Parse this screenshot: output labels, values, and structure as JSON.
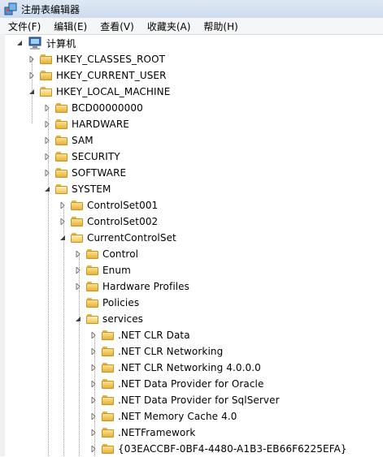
{
  "window": {
    "title": "注册表编辑器"
  },
  "menu": [
    "文件(F)",
    "编辑(E)",
    "查看(V)",
    "收藏夹(A)",
    "帮助(H)"
  ],
  "tree": {
    "root": "计算机",
    "nodes": [
      {
        "label": "HKEY_CLASSES_ROOT",
        "state": "collapsed"
      },
      {
        "label": "HKEY_CURRENT_USER",
        "state": "collapsed"
      },
      {
        "label": "HKEY_LOCAL_MACHINE",
        "state": "expanded"
      },
      {
        "label": "BCD00000000",
        "state": "collapsed"
      },
      {
        "label": "HARDWARE",
        "state": "collapsed"
      },
      {
        "label": "SAM",
        "state": "collapsed"
      },
      {
        "label": "SECURITY",
        "state": "collapsed"
      },
      {
        "label": "SOFTWARE",
        "state": "collapsed"
      },
      {
        "label": "SYSTEM",
        "state": "expanded"
      },
      {
        "label": "ControlSet001",
        "state": "collapsed"
      },
      {
        "label": "ControlSet002",
        "state": "collapsed"
      },
      {
        "label": "CurrentControlSet",
        "state": "expanded"
      },
      {
        "label": "Control",
        "state": "collapsed"
      },
      {
        "label": "Enum",
        "state": "collapsed"
      },
      {
        "label": "Hardware Profiles",
        "state": "collapsed"
      },
      {
        "label": "Policies",
        "state": "leaf"
      },
      {
        "label": "services",
        "state": "expanded"
      },
      {
        "label": ".NET CLR Data",
        "state": "collapsed"
      },
      {
        "label": ".NET CLR Networking",
        "state": "collapsed"
      },
      {
        "label": ".NET CLR Networking 4.0.0.0",
        "state": "collapsed"
      },
      {
        "label": ".NET Data Provider for Oracle",
        "state": "collapsed"
      },
      {
        "label": ".NET Data Provider for SqlServer",
        "state": "collapsed"
      },
      {
        "label": ".NET Memory Cache 4.0",
        "state": "collapsed"
      },
      {
        "label": ".NETFramework",
        "state": "collapsed"
      },
      {
        "label": "{03EACCBF-0BF4-4480-A1B3-EB66F6225EFA}",
        "state": "collapsed"
      }
    ]
  }
}
